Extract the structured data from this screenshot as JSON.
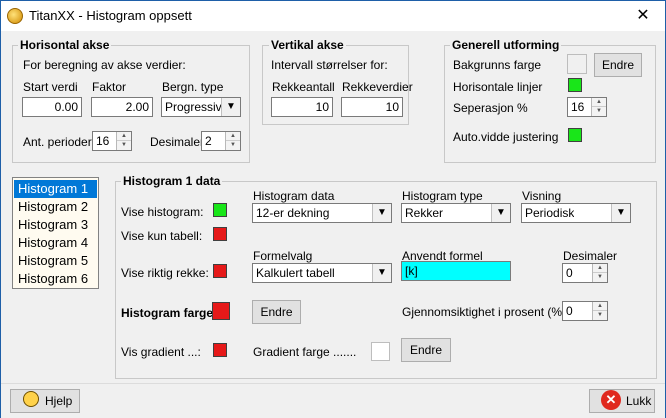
{
  "window": {
    "title": "TitanXX - Histogram oppsett",
    "close_glyph": "✕"
  },
  "horisontal": {
    "title": "Horisontal akse",
    "subtitle": "For beregning av akse verdier:",
    "start_label": "Start verdi",
    "start_value": "0.00",
    "faktor_label": "Faktor",
    "faktor_value": "2.00",
    "bergn_label": "Bergn. type",
    "bergn_value": "Progressivt",
    "perioder_label": "Ant. perioder",
    "perioder_value": "16",
    "desimaler_label": "Desimaler:",
    "desimaler_value": "2"
  },
  "vertikal": {
    "title": "Vertikal akse",
    "subtitle": "Intervall størrelser for:",
    "rekkeantall_label": "Rekkeantall",
    "rekkeantall_value": "10",
    "rekkeverdier_label": "Rekkeverdier",
    "rekkeverdier_value": "10"
  },
  "generell": {
    "title": "Generell utforming",
    "bakgrunn_label": "Bakgrunns farge",
    "endre_label": "Endre",
    "horisontale_label": "Horisontale linjer",
    "seperasjon_label": "Seperasjon %",
    "seperasjon_value": "16",
    "autovidde_label": "Auto.vidde justering"
  },
  "histograms": {
    "items": [
      "Histogram 1",
      "Histogram 2",
      "Histogram 3",
      "Histogram 4",
      "Histogram 5",
      "Histogram 6"
    ],
    "selected_index": 0
  },
  "histogram_data": {
    "title": "Histogram 1 data",
    "vise_histogram": "Vise histogram:",
    "vise_kun_tabell": "Vise kun tabell:",
    "vise_riktig_rekke": "Vise riktig rekke:",
    "histogram_farge": "Histogram farge:",
    "vis_gradient": "Vis gradient ...:",
    "hist_data_label": "Histogram data",
    "hist_data_value": "12-er dekning",
    "hist_type_label": "Histogram type",
    "hist_type_value": "Rekker",
    "visning_label": "Visning",
    "visning_value": "Periodisk",
    "formelvalg_label": "Formelvalg",
    "formelvalg_value": "Kalkulert tabell",
    "anvendt_label": "Anvendt formel",
    "anvendt_value": "[k]",
    "desimaler_label": "Desimaler",
    "desimaler_value": "0",
    "gjennom_label": "Gjennomsiktighet i prosent (%):",
    "gjennom_value": "0",
    "endre_label": "Endre",
    "gradient_label": "Gradient farge .......",
    "gradient_endre_label": "Endre"
  },
  "footer": {
    "hjelp_label": "Hjelp",
    "lukk_label": "Lukk"
  },
  "colors": {
    "green": "#19e619",
    "red": "#e61919",
    "cyan": "#00ffff",
    "white": "#ffffff",
    "selection": "#0078d7"
  }
}
